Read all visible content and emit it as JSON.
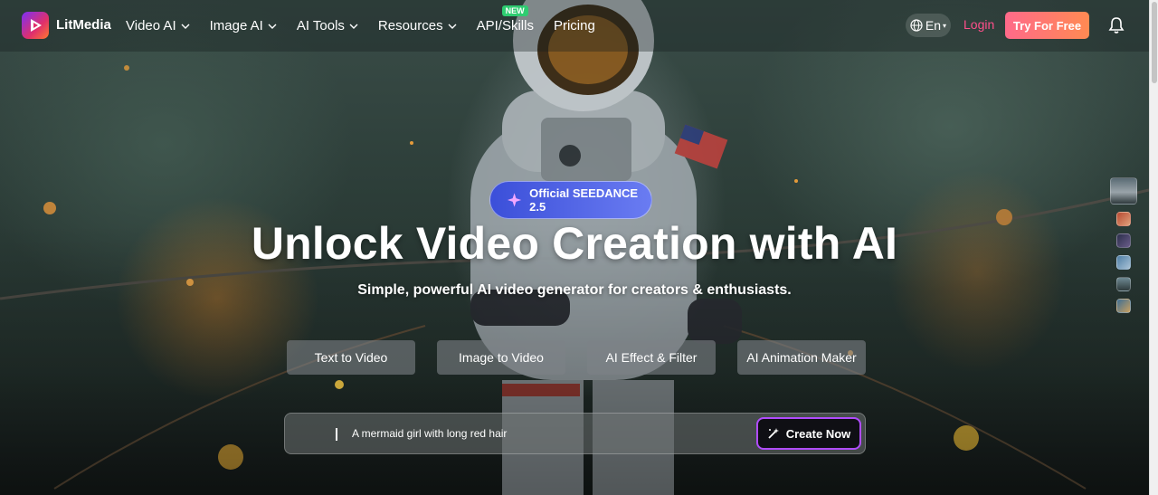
{
  "brand": {
    "name": "LitMedia"
  },
  "nav": {
    "items": [
      {
        "label": "Video AI",
        "has_dropdown": true
      },
      {
        "label": "Image AI",
        "has_dropdown": true
      },
      {
        "label": "AI Tools",
        "has_dropdown": true
      },
      {
        "label": "Resources",
        "has_dropdown": true
      },
      {
        "label": "API/Skills",
        "has_dropdown": false,
        "badge": "NEW"
      },
      {
        "label": "Pricing",
        "has_dropdown": false
      }
    ],
    "language": "En",
    "login_label": "Login",
    "cta_label": "Try For Free",
    "icons": [
      "globe-icon",
      "chevron-down-icon",
      "bell-icon"
    ]
  },
  "hero": {
    "pill_label": "Official SEEDANCE 2.5",
    "headline": "Unlock Video Creation with AI",
    "subheadline": "Simple, powerful AI video generator for creators & enthusiasts.",
    "modes": [
      "Text to Video",
      "Image to Video",
      "AI Effect & Filter",
      "AI Animation Maker"
    ],
    "prompt_placeholder": "A mermaid girl with long red hair",
    "create_label": "Create Now",
    "thumbnail_count": 6
  },
  "colors": {
    "accent_pink": "#ff4f8b",
    "cta_gradient_start": "#ff6a8a",
    "cta_gradient_end": "#ff8a52",
    "pill_blue": "#3b4fd9",
    "create_border": "#b04cff",
    "new_badge": "#2ecc71"
  }
}
